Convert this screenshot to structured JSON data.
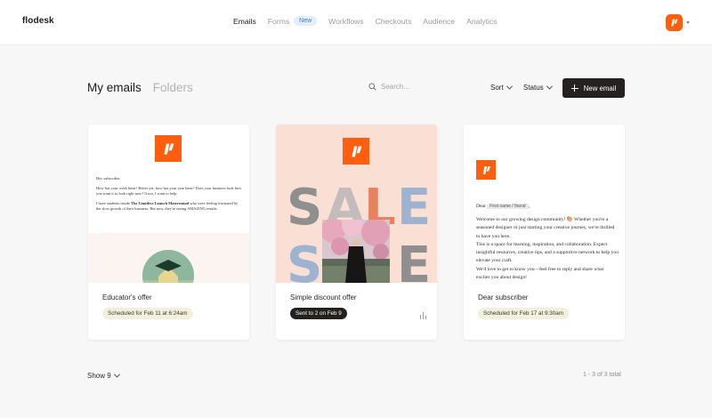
{
  "app": {
    "name": "flodesk"
  },
  "colors": {
    "brand": "#ff5e0e",
    "primary_button": "#262121",
    "scheduled_badge": "#f2f0dc",
    "sent_badge": "#232020",
    "new_badge": "#e3eef9"
  },
  "nav": {
    "items": [
      {
        "label": "Emails",
        "active": true
      },
      {
        "label": "Forms",
        "badge": "New"
      },
      {
        "label": "Workflows"
      },
      {
        "label": "Checkouts"
      },
      {
        "label": "Audience"
      },
      {
        "label": "Analytics"
      }
    ]
  },
  "header": {
    "tabs": [
      {
        "label": "My emails",
        "active": true
      },
      {
        "label": "Folders"
      }
    ],
    "search": {
      "placeholder": "Search...",
      "value": ""
    },
    "sort_label": "Sort",
    "status_label": "Status",
    "new_email_label": "New email"
  },
  "cards": [
    {
      "title": "Educator's offer",
      "status": "Scheduled for Feb 11 at 6:24am",
      "preview": {
        "greeting": "Hey subscriber,",
        "para1": "How has your week been? Better yet, how has your year been? Does your business look how you want it to look right now? If not, I want to help.",
        "para2_pre": "I have students inside ",
        "para2_bold": "The Limitless Launch Mastermind",
        "para2_post": " who were feeling frustrated by the slow growth of their business. But now, they're seeing AMAZING results."
      }
    },
    {
      "title": "Simple discount offer",
      "status": "Sent to 2 on Feb 9",
      "preview": {
        "letters": [
          "S",
          "A",
          "L",
          "E",
          "S",
          "E"
        ]
      }
    },
    {
      "title": "Dear subscriber",
      "status": "Scheduled for Feb 17 at 9:30am",
      "preview": {
        "dear": "Dear",
        "merge_tag": "First name / friend",
        "dear_suffix": ",",
        "line1": "Welcome to our growing design community! 🎨 Whether you're a seasoned designer or just starting your creative journey, we're thrilled to have you here.",
        "line2": "This is a space for learning, inspiration, and collaboration. Expect insightful resources, creative tips, and a supportive network to help you elevate your craft.",
        "line3": "We'd love to get to know you—feel free to reply and share what excites you about design!"
      }
    }
  ],
  "footer": {
    "show_label": "Show 9",
    "pagination": "1 - 3 of 3 total"
  }
}
